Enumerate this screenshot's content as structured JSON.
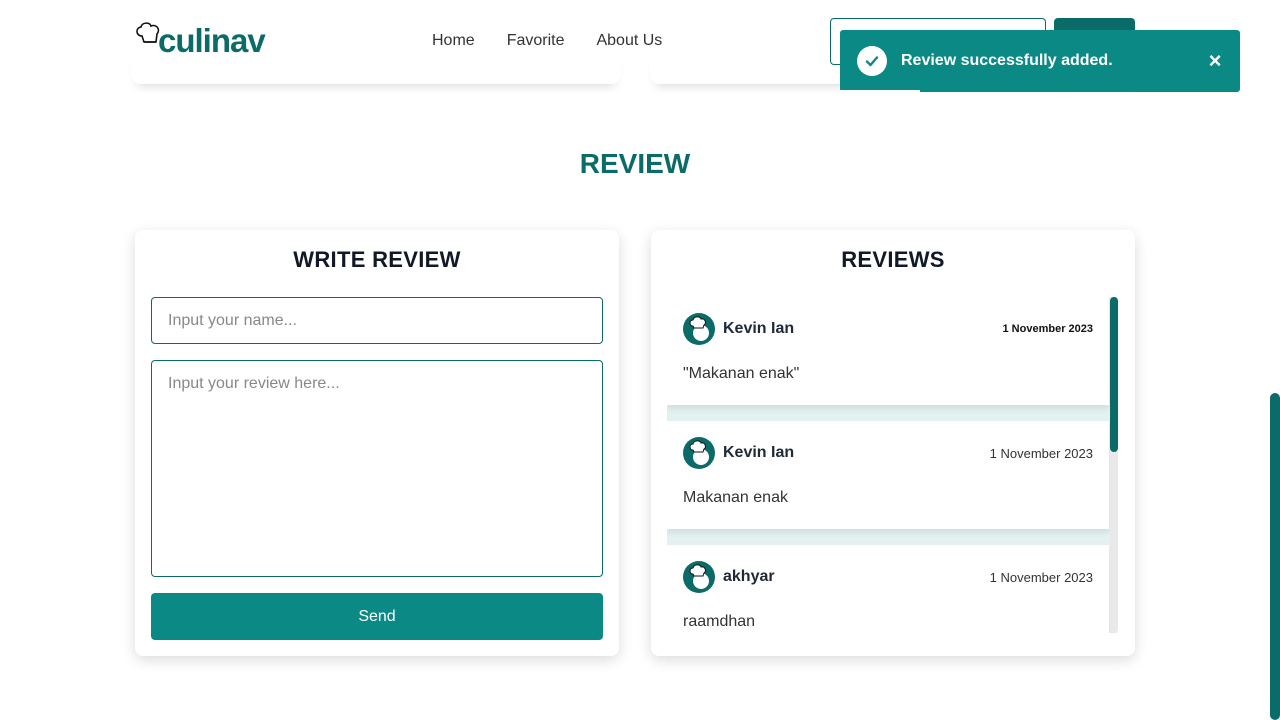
{
  "nav": {
    "logo_text": "culinav",
    "links": [
      "Home",
      "Favorite",
      "About Us"
    ]
  },
  "toast": {
    "message": "Review successfully added.",
    "close_symbol": "×",
    "progress": 0.2
  },
  "section": {
    "title": "REVIEW"
  },
  "write_review": {
    "title": "WRITE REVIEW",
    "name_placeholder": "Input your name...",
    "review_placeholder": "Input your review here...",
    "send_label": "Send"
  },
  "reviews": {
    "title": "REVIEWS",
    "items": [
      {
        "name": "Kevin Ian",
        "date": "1 November 2023",
        "text": "\"Makanan enak\""
      },
      {
        "name": "Kevin Ian",
        "date": "1 November 2023",
        "text": "Makanan enak"
      },
      {
        "name": "akhyar",
        "date": "1 November 2023",
        "text": "raamdhan"
      }
    ]
  },
  "colors": {
    "brand": "#0b6b68",
    "accent": "#0b8a85"
  },
  "icons": {
    "toast": "check-circle-icon",
    "avatar": "chef-avatar-icon",
    "logo": "chef-hat-icon"
  }
}
